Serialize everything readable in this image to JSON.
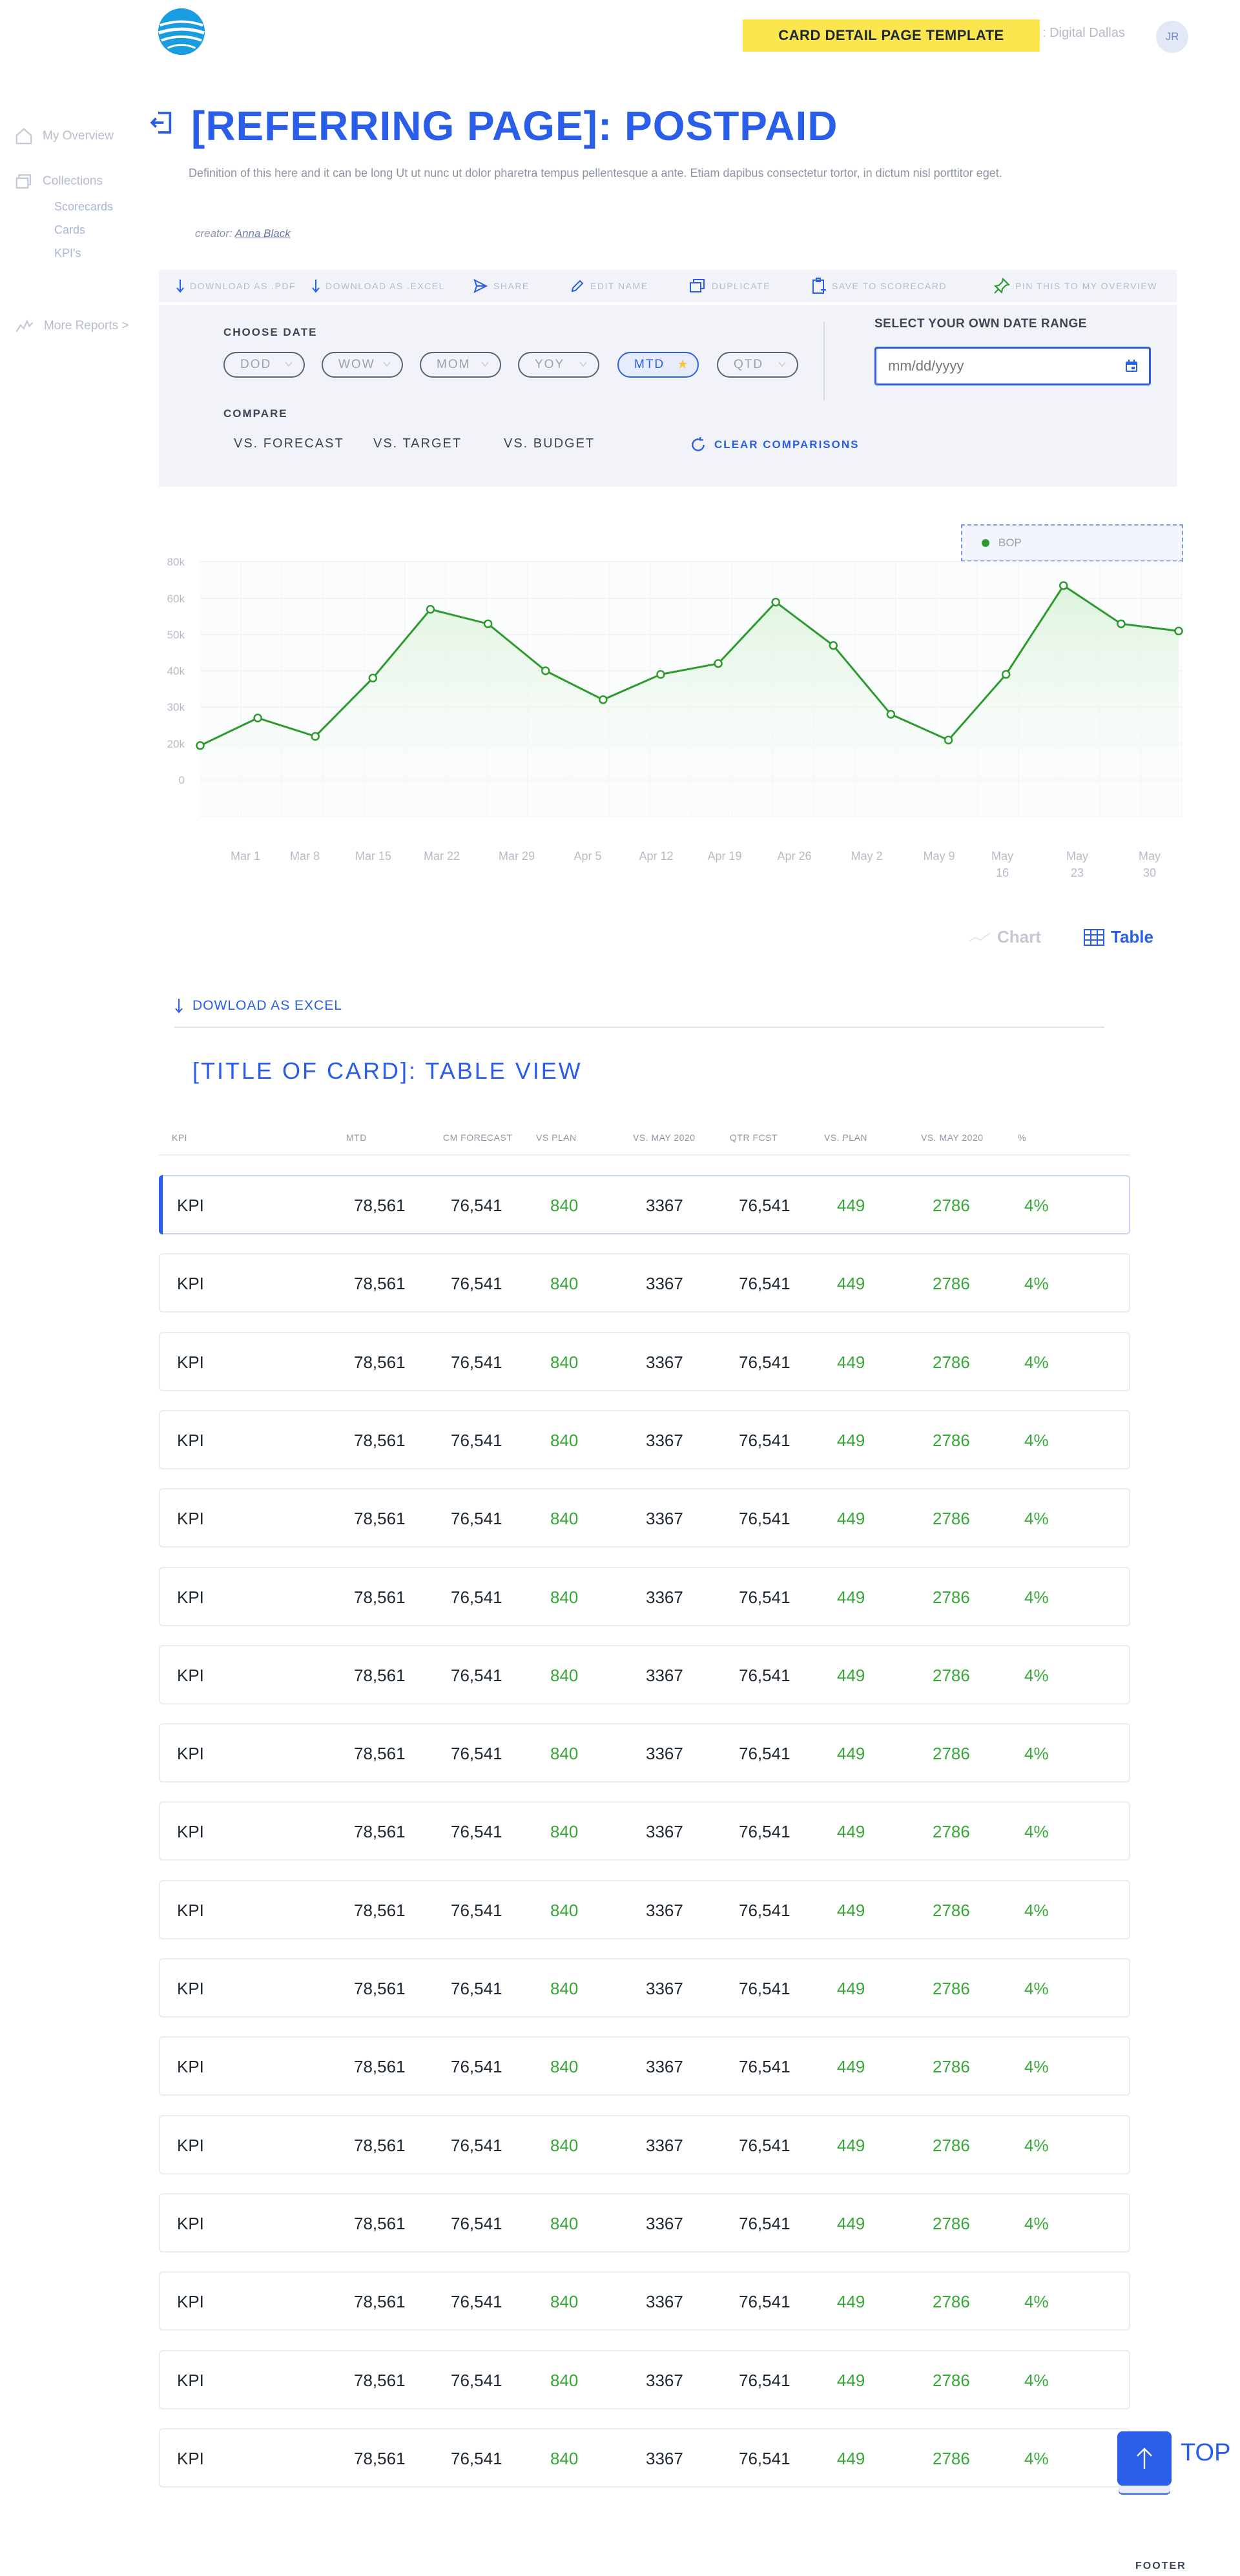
{
  "header": {
    "template_banner": "CARD DETAIL PAGE TEMPLATE",
    "org_name": ": Digital Dallas",
    "avatar_initials": "JR"
  },
  "sidebar": {
    "my_overview": "My Overview",
    "collections": "Collections",
    "sub_items": [
      "Scorecards",
      "Cards",
      "KPI's"
    ],
    "more_reports": "More Reports >"
  },
  "page": {
    "title": "[REFERRING PAGE]: POSTPAID",
    "description": "Definition of this here and it can be long Ut ut nunc ut dolor pharetra tempus pellentesque a ante. Etiam dapibus consectetur tortor, in dictum nisl porttitor eget.",
    "creator_label": "creator:",
    "creator_name": "Anna Black"
  },
  "toolbar": {
    "download_pdf": "DOWNLOAD AS .PDF",
    "download_excel": "DOWNLOAD AS .EXCEL",
    "share": "SHARE",
    "edit_name": "EDIT NAME",
    "duplicate": "DUPLICATE",
    "save_to_scorecard": "SAVE TO SCORECARD",
    "pin": "PIN THIS TO MY OVERVIEW"
  },
  "filters": {
    "choose_date_label": "CHOOSE DATE",
    "date_options": [
      "DOD",
      "WOW",
      "MOM",
      "YOY",
      "MTD",
      "QTD"
    ],
    "selected_date_option": "MTD",
    "compare_label": "COMPARE",
    "compare_options": [
      "VS. FORECAST",
      "VS. TARGET",
      "VS. BUDGET"
    ],
    "clear_comparisons": "CLEAR COMPARISONS",
    "range_label": "SELECT YOUR OWN DATE RANGE",
    "range_placeholder": "mm/dd/yyyy"
  },
  "chart_data": {
    "type": "line",
    "title": "",
    "xlabel": "",
    "ylabel": "",
    "legend": [
      "BOP"
    ],
    "legend_position": "top-right",
    "grid": true,
    "y_ticks": [
      "80k",
      "60k",
      "50k",
      "40k",
      "30k",
      "20k",
      "0"
    ],
    "x_ticks": [
      "Mar 1",
      "Mar 8",
      "Mar 15",
      "Mar 22",
      "Mar 29",
      "Apr 5",
      "Apr 12",
      "Apr 19",
      "Apr 26",
      "May 2",
      "May 9",
      "May 16",
      "May 23",
      "May 30"
    ],
    "series": [
      {
        "name": "BOP",
        "color": "#2d9a2d",
        "values": [
          19,
          27,
          22,
          38,
          57,
          53,
          40,
          32,
          39,
          42,
          59,
          47,
          28,
          21,
          39,
          67,
          53,
          51
        ]
      }
    ]
  },
  "view_toggle": {
    "chart_label": "Chart",
    "table_label": "Table",
    "active": "Table"
  },
  "table_section": {
    "download_label": "DOWLOAD AS EXCEL",
    "title": "[TITLE OF CARD]: TABLE VIEW",
    "columns": [
      "KPI",
      "MTD",
      "CM FORECAST",
      "VS PLAN",
      "VS. MAY 2020",
      "QTR FCST",
      "VS. PLAN",
      "VS. MAY 2020",
      "%"
    ],
    "rows": [
      [
        "KPI",
        "78,561",
        "76,541",
        "840",
        "3367",
        "76,541",
        "449",
        "2786",
        "4%"
      ],
      [
        "KPI",
        "78,561",
        "76,541",
        "840",
        "3367",
        "76,541",
        "449",
        "2786",
        "4%"
      ],
      [
        "KPI",
        "78,561",
        "76,541",
        "840",
        "3367",
        "76,541",
        "449",
        "2786",
        "4%"
      ],
      [
        "KPI",
        "78,561",
        "76,541",
        "840",
        "3367",
        "76,541",
        "449",
        "2786",
        "4%"
      ],
      [
        "KPI",
        "78,561",
        "76,541",
        "840",
        "3367",
        "76,541",
        "449",
        "2786",
        "4%"
      ],
      [
        "KPI",
        "78,561",
        "76,541",
        "840",
        "3367",
        "76,541",
        "449",
        "2786",
        "4%"
      ],
      [
        "KPI",
        "78,561",
        "76,541",
        "840",
        "3367",
        "76,541",
        "449",
        "2786",
        "4%"
      ],
      [
        "KPI",
        "78,561",
        "76,541",
        "840",
        "3367",
        "76,541",
        "449",
        "2786",
        "4%"
      ],
      [
        "KPI",
        "78,561",
        "76,541",
        "840",
        "3367",
        "76,541",
        "449",
        "2786",
        "4%"
      ],
      [
        "KPI",
        "78,561",
        "76,541",
        "840",
        "3367",
        "76,541",
        "449",
        "2786",
        "4%"
      ],
      [
        "KPI",
        "78,561",
        "76,541",
        "840",
        "3367",
        "76,541",
        "449",
        "2786",
        "4%"
      ],
      [
        "KPI",
        "78,561",
        "76,541",
        "840",
        "3367",
        "76,541",
        "449",
        "2786",
        "4%"
      ],
      [
        "KPI",
        "78,561",
        "76,541",
        "840",
        "3367",
        "76,541",
        "449",
        "2786",
        "4%"
      ],
      [
        "KPI",
        "78,561",
        "76,541",
        "840",
        "3367",
        "76,541",
        "449",
        "2786",
        "4%"
      ],
      [
        "KPI",
        "78,561",
        "76,541",
        "840",
        "3367",
        "76,541",
        "449",
        "2786",
        "4%"
      ],
      [
        "KPI",
        "78,561",
        "76,541",
        "840",
        "3367",
        "76,541",
        "449",
        "2786",
        "4%"
      ],
      [
        "KPI",
        "78,561",
        "76,541",
        "840",
        "3367",
        "76,541",
        "449",
        "2786",
        "4%"
      ]
    ],
    "positive_color": "#36a836"
  },
  "top_button": {
    "label": "TOP"
  },
  "footer": {
    "label": "FOOTER"
  }
}
